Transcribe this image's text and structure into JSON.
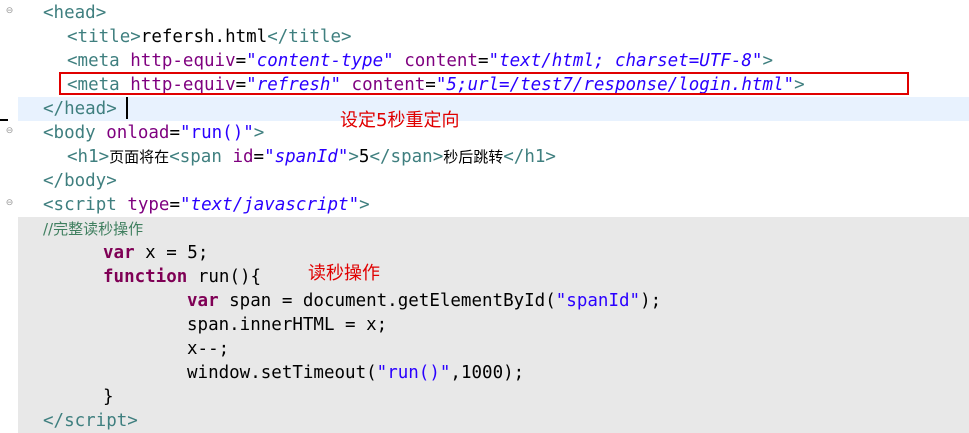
{
  "editor": {
    "lines": {
      "l1": {
        "open": "<",
        "tag": "head",
        "close": ">"
      },
      "l2": {
        "open": "<",
        "tag": "title",
        "mid": ">",
        "text": "refersh.html",
        "endopen": "</",
        "endtag": "title",
        "close": ">"
      },
      "l3": {
        "open": "<",
        "tag": "meta",
        "a1": "http-equiv",
        "eq1": "=",
        "v1": "\"content-type\"",
        "a2": "content",
        "eq2": "=",
        "v2": "\"text/html; charset=UTF-8\"",
        "close": ">"
      },
      "l4": {
        "open": "<",
        "tag": "meta",
        "a1": "http-equiv",
        "eq1": "=",
        "v1": "\"refresh\"",
        "a2": "content",
        "eq2": "=",
        "v2": "\"5;url=/test7/response/login.html\"",
        "close": ">"
      },
      "l5": {
        "open": "</",
        "tag": "head",
        "close": ">"
      },
      "l6": {
        "open": "<",
        "tag": "body",
        "a1": "onload",
        "eq1": "=",
        "v1": "\"run()\"",
        "close": ">"
      },
      "l7": {
        "open": "<",
        "tag": "h1",
        "mid": ">",
        "text": "页面将在",
        "open2": "<",
        "tag2": "span",
        "a1": "id",
        "eq1": "=",
        "v1": "\"spanId\"",
        "mid2": ">",
        "num": "5",
        "endopen": "</",
        "endtag": "span",
        "mid3": ">",
        "text2": "秒后跳转",
        "endopen2": "</",
        "endtag2": "h1",
        "close": ">"
      },
      "l8": {
        "open": "</",
        "tag": "body",
        "close": ">"
      },
      "l9": {
        "open": "<",
        "tag": "script",
        "a1": "type",
        "eq1": "=",
        "v1": "\"text/javascript\"",
        "close": ">"
      },
      "l10": {
        "comment": "//完整读秒操作"
      },
      "l11": {
        "kw": "var",
        "rest": " x = 5;"
      },
      "l12": {
        "kw": "function",
        "rest": " run(){"
      },
      "l13": {
        "kw": "var",
        "rest": " span = document.getElementById(",
        "str": "\"spanId\"",
        "end": ");"
      },
      "l14": {
        "text": "span.innerHTML = x;"
      },
      "l15": {
        "text": "x--;"
      },
      "l16": {
        "pre": "window.setTimeout(",
        "str": "\"run()\"",
        "end": ",1000);"
      },
      "l17": {
        "text": "}"
      },
      "l18": {
        "open": "</",
        "tag": "script",
        "close": ">"
      }
    },
    "annotations": {
      "redirect_note": "设定5秒重定向",
      "countdown_note": "读秒操作"
    },
    "fold_markers": {
      "f1": "⊖",
      "f2": "⊖",
      "f3": "⊖"
    },
    "colors": {
      "tag": "#3f7f7f",
      "attribute": "#7f007f",
      "string": "#2a00ff",
      "keyword": "#7f0055",
      "comment": "#3f7f5f",
      "annotation": "#e00000",
      "script_region_background": "#e8e8e8",
      "current_line": "#e8f2fe"
    }
  }
}
